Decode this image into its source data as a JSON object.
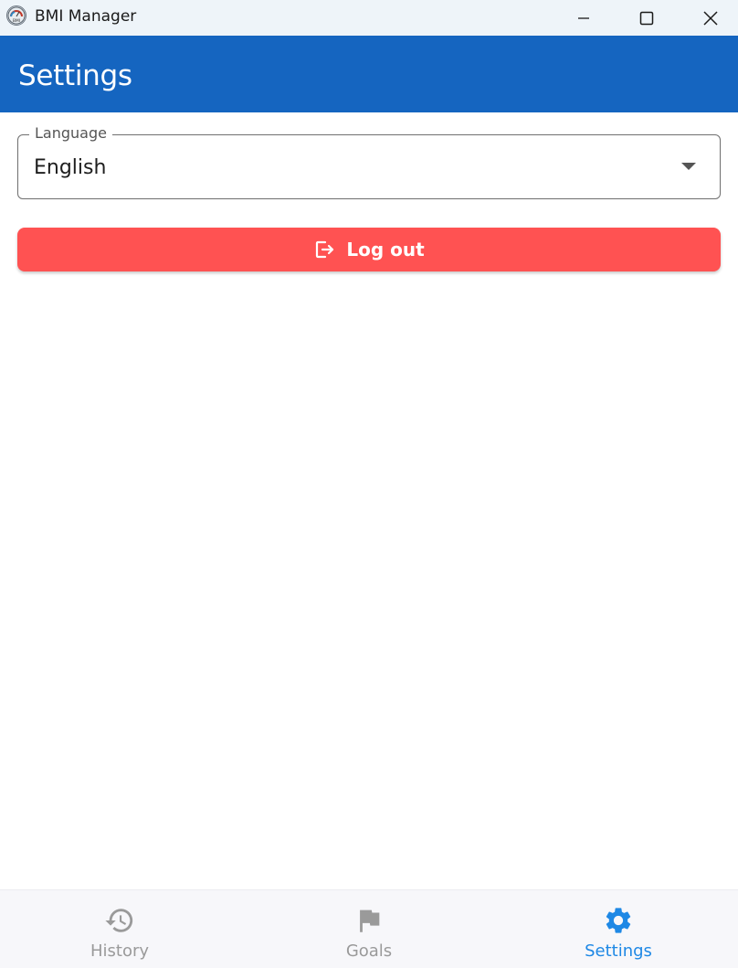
{
  "window": {
    "title": "BMI Manager",
    "icon": "bmi-app-icon",
    "app_icon_text": "BMI"
  },
  "appbar": {
    "title": "Settings",
    "color": "#1565c0"
  },
  "language_field": {
    "label": "Language",
    "value": "English"
  },
  "logout": {
    "label": "Log out",
    "icon": "logout-icon",
    "color": "#ff5252"
  },
  "bottom_nav": {
    "items": [
      {
        "label": "History",
        "icon": "history-icon",
        "active": false
      },
      {
        "label": "Goals",
        "icon": "flag-icon",
        "active": false
      },
      {
        "label": "Settings",
        "icon": "gear-icon",
        "active": true
      }
    ],
    "active_color": "#1e88e5",
    "inactive_color": "#9a9a9a"
  }
}
